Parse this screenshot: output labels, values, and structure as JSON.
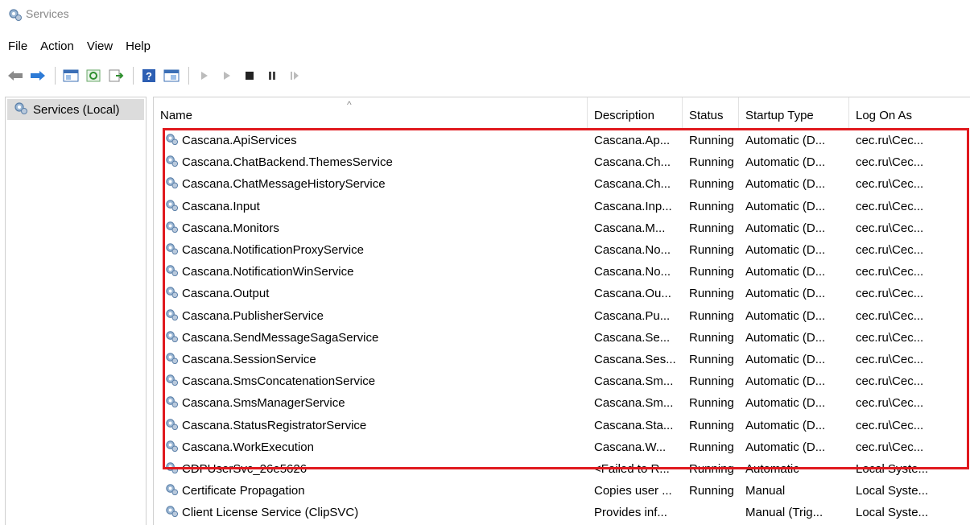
{
  "window": {
    "title": "Services"
  },
  "menu": [
    "File",
    "Action",
    "View",
    "Help"
  ],
  "toolbar": {
    "icons": [
      "back-icon",
      "forward-icon",
      "show-tree-icon",
      "refresh-icon",
      "export-icon",
      "help-icon",
      "properties-icon",
      "start-icon",
      "start-alt-icon",
      "stop-icon",
      "pause-icon",
      "resume-icon"
    ]
  },
  "tree": {
    "root_label": "Services (Local)"
  },
  "columns": {
    "name": "Name",
    "description": "Description",
    "status": "Status",
    "startup": "Startup Type",
    "logon": "Log On As"
  },
  "rows": [
    {
      "name": "Cascana.ApiServices",
      "description": "Cascana.Ap...",
      "status": "Running",
      "startup": "Automatic (D...",
      "logon": "cec.ru\\Cec..."
    },
    {
      "name": "Cascana.ChatBackend.ThemesService",
      "description": "Cascana.Ch...",
      "status": "Running",
      "startup": "Automatic (D...",
      "logon": "cec.ru\\Cec..."
    },
    {
      "name": "Cascana.ChatMessageHistoryService",
      "description": "Cascana.Ch...",
      "status": "Running",
      "startup": "Automatic (D...",
      "logon": "cec.ru\\Cec..."
    },
    {
      "name": "Cascana.Input",
      "description": "Cascana.Inp...",
      "status": "Running",
      "startup": "Automatic (D...",
      "logon": "cec.ru\\Cec..."
    },
    {
      "name": "Cascana.Monitors",
      "description": "Cascana.M...",
      "status": "Running",
      "startup": "Automatic (D...",
      "logon": "cec.ru\\Cec..."
    },
    {
      "name": "Cascana.NotificationProxyService",
      "description": "Cascana.No...",
      "status": "Running",
      "startup": "Automatic (D...",
      "logon": "cec.ru\\Cec..."
    },
    {
      "name": "Cascana.NotificationWinService",
      "description": "Cascana.No...",
      "status": "Running",
      "startup": "Automatic (D...",
      "logon": "cec.ru\\Cec..."
    },
    {
      "name": "Cascana.Output",
      "description": "Cascana.Ou...",
      "status": "Running",
      "startup": "Automatic (D...",
      "logon": "cec.ru\\Cec..."
    },
    {
      "name": "Cascana.PublisherService",
      "description": "Cascana.Pu...",
      "status": "Running",
      "startup": "Automatic (D...",
      "logon": "cec.ru\\Cec..."
    },
    {
      "name": "Cascana.SendMessageSagaService",
      "description": "Cascana.Se...",
      "status": "Running",
      "startup": "Automatic (D...",
      "logon": "cec.ru\\Cec..."
    },
    {
      "name": "Cascana.SessionService",
      "description": "Cascana.Ses...",
      "status": "Running",
      "startup": "Automatic (D...",
      "logon": "cec.ru\\Cec..."
    },
    {
      "name": "Cascana.SmsConcatenationService",
      "description": "Cascana.Sm...",
      "status": "Running",
      "startup": "Automatic (D...",
      "logon": "cec.ru\\Cec..."
    },
    {
      "name": "Cascana.SmsManagerService",
      "description": "Cascana.Sm...",
      "status": "Running",
      "startup": "Automatic (D...",
      "logon": "cec.ru\\Cec..."
    },
    {
      "name": "Cascana.StatusRegistratorService",
      "description": "Cascana.Sta...",
      "status": "Running",
      "startup": "Automatic (D...",
      "logon": "cec.ru\\Cec..."
    },
    {
      "name": "Cascana.WorkExecution",
      "description": "Cascana.W...",
      "status": "Running",
      "startup": "Automatic (D...",
      "logon": "cec.ru\\Cec..."
    },
    {
      "name": "CDPUserSvc_26e5626",
      "description": "<Failed to R...",
      "status": "Running",
      "startup": "Automatic",
      "logon": "Local Syste..."
    },
    {
      "name": "Certificate Propagation",
      "description": "Copies user ...",
      "status": "Running",
      "startup": "Manual",
      "logon": "Local Syste..."
    },
    {
      "name": "Client License Service (ClipSVC)",
      "description": "Provides inf...",
      "status": "",
      "startup": "Manual (Trig...",
      "logon": "Local Syste..."
    }
  ],
  "annotation_color": "#e0191e"
}
